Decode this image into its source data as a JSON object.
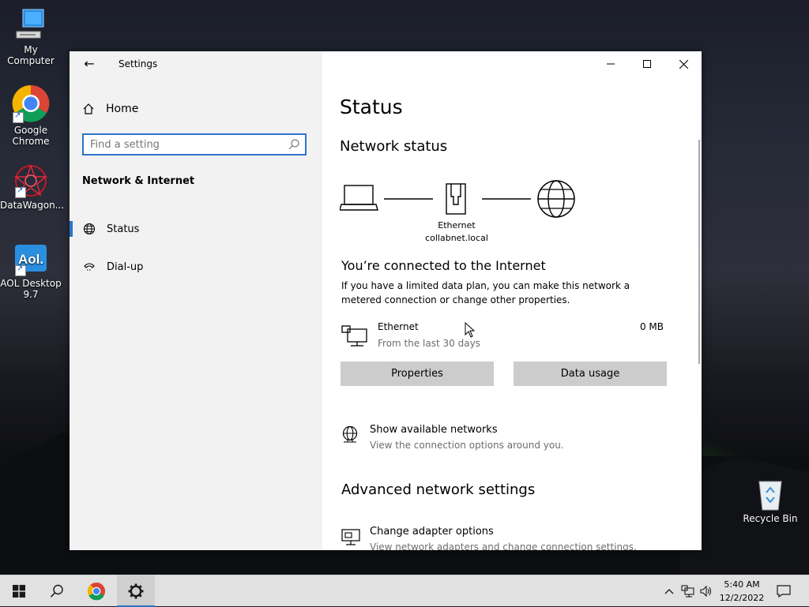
{
  "desktop": {
    "icons": [
      {
        "label": "My Computer"
      },
      {
        "label": "Google Chrome"
      },
      {
        "label": "DataWagon..."
      },
      {
        "label": "AOL Desktop 9.7"
      },
      {
        "label": "Recycle Bin"
      }
    ]
  },
  "window": {
    "title": "Settings",
    "controls": {
      "minimize": "minimize",
      "maximize": "maximize",
      "close": "close"
    }
  },
  "sidebar": {
    "home_label": "Home",
    "search_placeholder": "Find a setting",
    "section_title": "Network & Internet",
    "items": [
      {
        "label": "Status",
        "icon": "globe-icon",
        "selected": true
      },
      {
        "label": "Dial-up",
        "icon": "phone-icon",
        "selected": false
      }
    ]
  },
  "main": {
    "page_title": "Status",
    "network_status_title": "Network status",
    "diagram": {
      "adapter_name": "Ethernet",
      "network_name": "collabnet.local"
    },
    "connected_heading": "You’re connected to the Internet",
    "connected_desc": "If you have a limited data plan, you can make this network a metered connection or change other properties.",
    "connection": {
      "name": "Ethernet",
      "period": "From the last 30 days",
      "usage": "0 MB"
    },
    "buttons": {
      "properties": "Properties",
      "data_usage": "Data usage"
    },
    "show_networks": {
      "title": "Show available networks",
      "subtitle": "View the connection options around you."
    },
    "advanced_title": "Advanced network settings",
    "adapter_options": {
      "title": "Change adapter options",
      "subtitle": "View network adapters and change connection settings."
    }
  },
  "taskbar": {
    "time": "5:40 AM",
    "date": "12/2/2022"
  },
  "colors": {
    "accent": "#2b74c9",
    "sidebar_bg": "#f2f2f2",
    "button_bg": "#cccccc",
    "taskbar_bg": "#e1e1e1"
  }
}
